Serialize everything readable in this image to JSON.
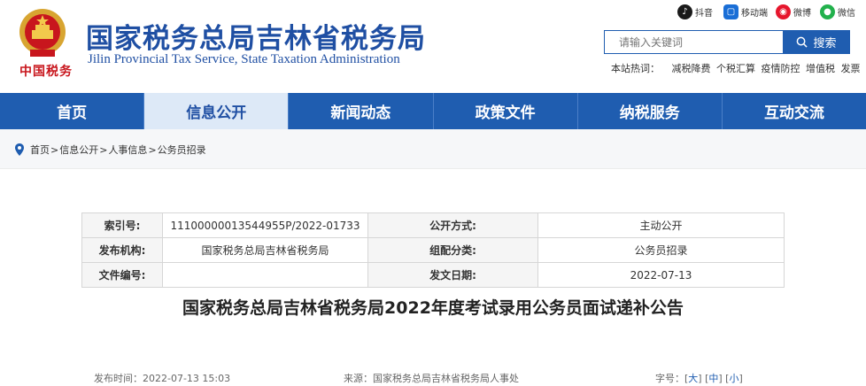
{
  "header": {
    "site_title": "国家税务总局吉林省税务局",
    "site_subtitle": "Jilin Provincial Tax Service, State Taxation Administration",
    "brand_script": "中国税务"
  },
  "social": {
    "douyin": "抖音",
    "mobile": "移动端",
    "weibo": "微博",
    "wechat": "微信"
  },
  "search": {
    "placeholder": "请输入关键词",
    "button_label": "搜索"
  },
  "hot": {
    "label": "本站热词：",
    "links": [
      "减税降费",
      "个税汇算",
      "疫情防控",
      "增值税",
      "发票"
    ]
  },
  "nav": {
    "items": [
      "首页",
      "信息公开",
      "新闻动态",
      "政策文件",
      "纳税服务",
      "互动交流"
    ],
    "active_index": 1
  },
  "breadcrumb": {
    "items": [
      "首页",
      "信息公开",
      "人事信息",
      "公务员招录"
    ],
    "separator": ">"
  },
  "info": {
    "index_label": "索引号:",
    "index_value": "11100000013544955P/2022-01733",
    "open_mode_label": "公开方式:",
    "open_mode_value": "主动公开",
    "publisher_label": "发布机构:",
    "publisher_value": "国家税务总局吉林省税务局",
    "category_label": "组配分类:",
    "category_value": "公务员招录",
    "doc_no_label": "文件编号:",
    "doc_no_value": "",
    "date_label": "发文日期:",
    "date_value": "2022-07-13"
  },
  "article": {
    "title": "国家税务总局吉林省税务局2022年度考试录用公务员面试递补公告",
    "publish_time": "发布时间：2022-07-13 15:03",
    "source": "来源：国家税务总局吉林省税务局人事处",
    "font_size_label": "字号：[",
    "font_sizes": [
      "大",
      "中",
      "小"
    ]
  },
  "colors": {
    "primary": "#1f5db0",
    "brand_red": "#c8161d",
    "nav_active_bg": "#dde9f7"
  }
}
